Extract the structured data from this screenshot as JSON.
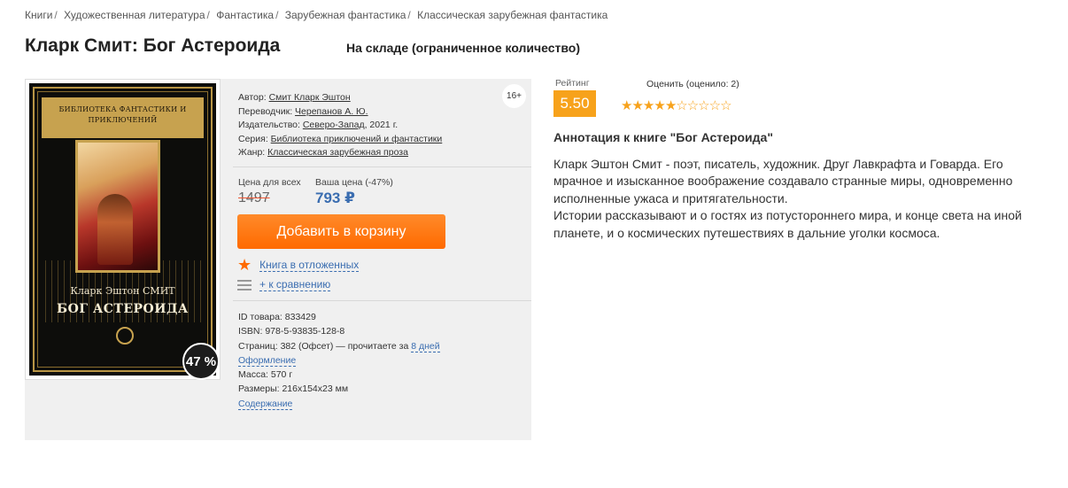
{
  "breadcrumbs": [
    "Книги",
    "Художественная литература",
    "Фантастика",
    "Зарубежная фантастика",
    "Классическая зарубежная фантастика"
  ],
  "title": "Кларк Смит: Бог Астероида",
  "stock": "На складе (ограниченное количество)",
  "cover": {
    "series_text": "БИБЛИОТЕКА ФАНТАСТИКИ И ПРИКЛЮЧЕНИЙ",
    "author": "Кларк Эштон СМИТ",
    "title": "БОГ АСТЕРОИДА",
    "discount_badge": "47 %"
  },
  "age_rating": "16+",
  "details": {
    "author_label": "Автор:",
    "author": "Смит Кларк Эштон",
    "translator_label": "Переводчик:",
    "translator": "Черепанов А. Ю.",
    "publisher_label": "Издательство:",
    "publisher": "Северо-Запад",
    "year": ", 2021 г.",
    "series_label": "Серия:",
    "series": "Библиотека приключений и фантастики",
    "genre_label": "Жанр:",
    "genre": "Классическая зарубежная проза"
  },
  "price": {
    "all_label": "Цена для всех",
    "old": "1497",
    "your_label": "Ваша цена (-47%)",
    "new": "793 ₽"
  },
  "actions": {
    "cart": "Добавить в корзину",
    "defer": "Книга в отложенных",
    "compare": "+ к сравнению"
  },
  "specs": {
    "id": "ID товара: 833429",
    "isbn": "ISBN: 978-5-93835-128-8",
    "pages": "Страниц: 382 (Офсет) — прочитаете за",
    "pages_days": "8 дней",
    "design": "Оформление",
    "mass": "Масса: 570 г",
    "size": "Размеры: 216x154x23 мм",
    "contents": "Содержание"
  },
  "rating": {
    "label": "Рейтинг",
    "value": "5.50",
    "rate_label": "Оценить (оценило: 2)",
    "stars_filled": 5,
    "stars_total": 10
  },
  "annotation": {
    "title": "Аннотация к книге \"Бог Астероида\"",
    "p1": "Кларк Эштон Смит - поэт, писатель, художник. Друг Лавкрафта и Говарда. Его мрачное и изысканное воображение создавало странные миры, одновременно исполненные ужаса и притягательности.",
    "p2": "Истории рассказывают и о гостях из потустороннего мира, и конце света на иной планете, и о космических путешествиях в дальние уголки космоса."
  },
  "colors": {
    "accent": "#ff6a00",
    "link": "#3a6db0",
    "rating": "#f7a21b"
  }
}
